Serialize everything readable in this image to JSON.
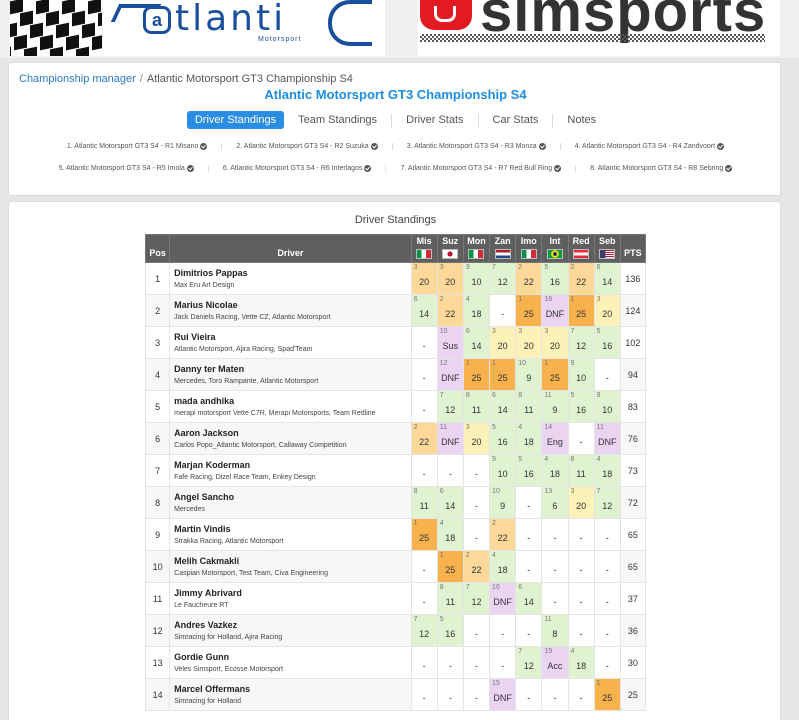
{
  "logos": {
    "left_small": "Motorsport",
    "atlantic_prefix": "a",
    "atlantic_text": "tlanti",
    "atlantic_end": "C",
    "sim_text": "simsports"
  },
  "breadcrumb": {
    "root": "Championship manager",
    "separator": "/",
    "current": "Atlantic Motorsport GT3 Championship S4"
  },
  "title": "Atlantic Motorsport GT3 Championship S4",
  "tabs": [
    {
      "label": "Driver Standings",
      "active": true
    },
    {
      "label": "Team Standings",
      "active": false
    },
    {
      "label": "Driver Stats",
      "active": false
    },
    {
      "label": "Car Stats",
      "active": false
    },
    {
      "label": "Notes",
      "active": false
    }
  ],
  "rounds_row1": [
    "1. Atlantic Motorsport GT3 S4 - R1 Misano",
    "2. Atlantic Motorsport GT3 S4 - R2 Suzuka",
    "3. Atlantic Motorsport GT3 S4 - R3 Monza",
    "4. Atlantic Motorsport GT3 S4 - R4 Zandvoort"
  ],
  "rounds_row2": [
    "5. Atlantic Motorsport GT3 S4 - R5 Imola",
    "6. Atlantic Motorsport GT3 S4 - R6 Interlagos",
    "7. Atlantic Motorsport GT3 S4 - R7 Red Bull Ring",
    "8. Atlantic Motorsport GT3 S4 - R8 Sebring"
  ],
  "standings_title": "Driver Standings",
  "table": {
    "pos_header": "Pos",
    "driver_header": "Driver",
    "pts_header": "PTS",
    "races": [
      {
        "short": "Mis",
        "flag": "italy"
      },
      {
        "short": "Suz",
        "flag": "japan"
      },
      {
        "short": "Mon",
        "flag": "italy"
      },
      {
        "short": "Zan",
        "flag": "netherlands"
      },
      {
        "short": "Imo",
        "flag": "italy"
      },
      {
        "short": "Int",
        "flag": "brazil"
      },
      {
        "short": "Red",
        "flag": "austria"
      },
      {
        "short": "Seb",
        "flag": "usa"
      }
    ],
    "rows": [
      {
        "pos": "1",
        "name": "Dimitrios Pappas",
        "team": "Max Eru Art Design",
        "pts": "136",
        "results": [
          [
            "3",
            "20",
            "o"
          ],
          [
            "3",
            "20",
            "o"
          ],
          [
            "9",
            "10",
            "g"
          ],
          [
            "7",
            "12",
            "g"
          ],
          [
            "2",
            "22",
            "o"
          ],
          [
            "5",
            "16",
            "g"
          ],
          [
            "2",
            "22",
            "o"
          ],
          [
            "6",
            "14",
            "g"
          ]
        ]
      },
      {
        "pos": "2",
        "name": "Marius Nicolae",
        "team": "Jack Daniels Racing, Vette CZ, Atlantic Motorsport",
        "pts": "124",
        "results": [
          [
            "6",
            "14",
            "g"
          ],
          [
            "2",
            "22",
            "o"
          ],
          [
            "4",
            "18",
            "g"
          ],
          [
            "",
            "-",
            "w"
          ],
          [
            "1",
            "25",
            "f"
          ],
          [
            "16",
            "DNF",
            "p"
          ],
          [
            "1",
            "25",
            "f"
          ],
          [
            "3",
            "20",
            "y"
          ]
        ]
      },
      {
        "pos": "3",
        "name": "Rui Vieira",
        "team": "Atlantic Motorsport, Ajira Racing, Spad'Team",
        "pts": "102",
        "results": [
          [
            "",
            "-",
            "w"
          ],
          [
            "10",
            "Sus",
            "p"
          ],
          [
            "6",
            "14",
            "g"
          ],
          [
            "3",
            "20",
            "y"
          ],
          [
            "3",
            "20",
            "y"
          ],
          [
            "3",
            "20",
            "y"
          ],
          [
            "7",
            "12",
            "g"
          ],
          [
            "5",
            "16",
            "g"
          ]
        ]
      },
      {
        "pos": "4",
        "name": "Danny ter Maten",
        "team": "Mercedes, Toro Rampante, Atlantic Motorsport",
        "pts": "94",
        "results": [
          [
            "",
            "-",
            "w"
          ],
          [
            "12",
            "DNF",
            "p"
          ],
          [
            "1",
            "25",
            "f"
          ],
          [
            "1",
            "25",
            "f"
          ],
          [
            "10",
            "9",
            "g"
          ],
          [
            "1",
            "25",
            "f"
          ],
          [
            "9",
            "10",
            "g"
          ],
          [
            "",
            "-",
            "w"
          ]
        ]
      },
      {
        "pos": "5",
        "name": "mada andhika",
        "team": "merapi motorsport Vette C7R, Merapi Motorsports, Team Redline",
        "pts": "83",
        "results": [
          [
            "",
            "-",
            "w"
          ],
          [
            "7",
            "12",
            "g"
          ],
          [
            "8",
            "11",
            "g"
          ],
          [
            "6",
            "14",
            "g"
          ],
          [
            "8",
            "11",
            "g"
          ],
          [
            "11",
            "9",
            "g"
          ],
          [
            "5",
            "16",
            "g"
          ],
          [
            "9",
            "10",
            "g"
          ]
        ]
      },
      {
        "pos": "6",
        "name": "Aaron Jackson",
        "team": "Carlos Popo_Atlantic Motorsport, Callaway Competition",
        "pts": "76",
        "results": [
          [
            "2",
            "22",
            "o"
          ],
          [
            "11",
            "DNF",
            "p"
          ],
          [
            "3",
            "20",
            "y"
          ],
          [
            "5",
            "16",
            "g"
          ],
          [
            "4",
            "18",
            "g"
          ],
          [
            "14",
            "Eng",
            "p"
          ],
          [
            "",
            "-",
            "w"
          ],
          [
            "11",
            "DNF",
            "p"
          ]
        ]
      },
      {
        "pos": "7",
        "name": "Marjan Koderman",
        "team": "Fafe Racing, Dizel Race Team, Enkey Design",
        "pts": "73",
        "results": [
          [
            "",
            "-",
            "w"
          ],
          [
            "",
            "-",
            "w"
          ],
          [
            "",
            "-",
            "w"
          ],
          [
            "9",
            "10",
            "g"
          ],
          [
            "5",
            "16",
            "g"
          ],
          [
            "4",
            "18",
            "g"
          ],
          [
            "8",
            "11",
            "g"
          ],
          [
            "4",
            "18",
            "g"
          ]
        ]
      },
      {
        "pos": "8",
        "name": "Angel Sancho",
        "team": "Mercedes",
        "pts": "72",
        "results": [
          [
            "8",
            "11",
            "g"
          ],
          [
            "6",
            "14",
            "g"
          ],
          [
            "",
            "-",
            "w"
          ],
          [
            "10",
            "9",
            "g"
          ],
          [
            "",
            "-",
            "w"
          ],
          [
            "13",
            "6",
            "g"
          ],
          [
            "3",
            "20",
            "y"
          ],
          [
            "7",
            "12",
            "g"
          ]
        ]
      },
      {
        "pos": "9",
        "name": "Martin Vindis",
        "team": "Strakka Racing, Atlantic Motorsport",
        "pts": "65",
        "results": [
          [
            "1",
            "25",
            "f"
          ],
          [
            "4",
            "18",
            "g"
          ],
          [
            "",
            "-",
            "w"
          ],
          [
            "2",
            "22",
            "o"
          ],
          [
            "",
            "-",
            "w"
          ],
          [
            "",
            "-",
            "w"
          ],
          [
            "",
            "-",
            "w"
          ],
          [
            "",
            "-",
            "w"
          ]
        ]
      },
      {
        "pos": "10",
        "name": "Melih Cakmakli",
        "team": "Caspian Motorsport, Test Team, Civa Engineering",
        "pts": "65",
        "results": [
          [
            "",
            "-",
            "w"
          ],
          [
            "1",
            "25",
            "f"
          ],
          [
            "2",
            "22",
            "o"
          ],
          [
            "4",
            "18",
            "g"
          ],
          [
            "",
            "-",
            "w"
          ],
          [
            "",
            "-",
            "w"
          ],
          [
            "",
            "-",
            "w"
          ],
          [
            "",
            "-",
            "w"
          ]
        ]
      },
      {
        "pos": "11",
        "name": "Jimmy Abrivard",
        "team": "Le Faucheure RT",
        "pts": "37",
        "results": [
          [
            "",
            "-",
            "w"
          ],
          [
            "8",
            "11",
            "g"
          ],
          [
            "7",
            "12",
            "g"
          ],
          [
            "16",
            "DNF",
            "p"
          ],
          [
            "6",
            "14",
            "g"
          ],
          [
            "",
            "-",
            "w"
          ],
          [
            "",
            "-",
            "w"
          ],
          [
            "",
            "-",
            "w"
          ]
        ]
      },
      {
        "pos": "12",
        "name": "Andres Vazkez",
        "team": "Simracing for Holland, Ajira Racing",
        "pts": "36",
        "results": [
          [
            "7",
            "12",
            "g"
          ],
          [
            "5",
            "16",
            "g"
          ],
          [
            "",
            "-",
            "w"
          ],
          [
            "",
            "-",
            "w"
          ],
          [
            "",
            "-",
            "w"
          ],
          [
            "11",
            "8",
            "g"
          ],
          [
            "",
            "-",
            "w"
          ],
          [
            "",
            "-",
            "w"
          ]
        ]
      },
      {
        "pos": "13",
        "name": "Gordie Gunn",
        "team": "Veles Simsport, Ecosse Motorsport",
        "pts": "30",
        "results": [
          [
            "",
            "-",
            "w"
          ],
          [
            "",
            "-",
            "w"
          ],
          [
            "",
            "-",
            "w"
          ],
          [
            "",
            "-",
            "w"
          ],
          [
            "7",
            "12",
            "g"
          ],
          [
            "19",
            "Acc",
            "p"
          ],
          [
            "4",
            "18",
            "g"
          ],
          [
            "",
            "-",
            "w"
          ]
        ]
      },
      {
        "pos": "14",
        "name": "Marcel Offermans",
        "team": "Simracing for Holland",
        "pts": "25",
        "results": [
          [
            "",
            "-",
            "w"
          ],
          [
            "",
            "-",
            "w"
          ],
          [
            "",
            "-",
            "w"
          ],
          [
            "15",
            "DNF",
            "p"
          ],
          [
            "",
            "-",
            "w"
          ],
          [
            "",
            "-",
            "w"
          ],
          [
            "",
            "-",
            "w"
          ],
          [
            "1",
            "25",
            "f"
          ]
        ]
      }
    ]
  }
}
